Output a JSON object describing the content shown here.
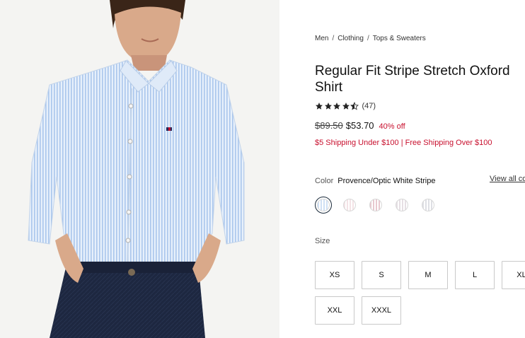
{
  "product": {
    "breadcrumb": [
      "Men",
      "Clothing",
      "Tops & Sweaters"
    ],
    "title": "Regular Fit Stripe Stretch Oxford Shirt",
    "rating": {
      "stars": 4.5,
      "count": "(47)"
    },
    "price": {
      "original": "$89.50",
      "sale": "$53.70",
      "discount": "40% off"
    },
    "shipping": "$5 Shipping Under $100 | Free Shipping Over $100",
    "color": {
      "label": "Color",
      "selected": "Provence/Optic White Stripe",
      "view_all": "View all co",
      "swatches": [
        {
          "name": "Provence/Optic White Stripe",
          "color": "#cfe0f5",
          "selected": true
        },
        {
          "name": "Pink Stripe",
          "color": "#f4e3e6",
          "selected": false
        },
        {
          "name": "Red Stripe",
          "color": "#e8c8cf",
          "selected": false
        },
        {
          "name": "Multi Stripe",
          "color": "#e6dfe4",
          "selected": false
        },
        {
          "name": "Grey Stripe",
          "color": "#dedfe4",
          "selected": false
        }
      ]
    },
    "size": {
      "label": "Size",
      "options": [
        "XS",
        "S",
        "M",
        "L",
        "XL",
        "XXL",
        "XXXL"
      ]
    }
  },
  "colors": {
    "sale_red": "#c8102e",
    "text": "#111111"
  }
}
